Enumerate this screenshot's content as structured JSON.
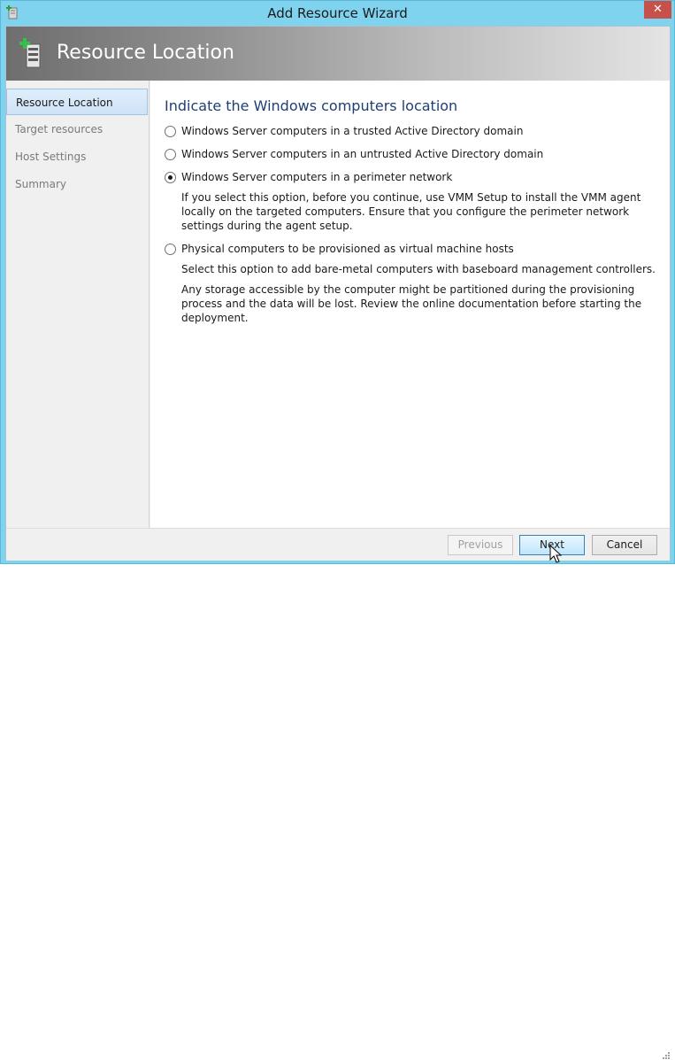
{
  "window": {
    "title": "Add Resource Wizard",
    "close_glyph": "✕"
  },
  "banner": {
    "title": "Resource Location",
    "icon": "server-add-icon"
  },
  "nav": {
    "items": [
      {
        "label": "Resource Location",
        "active": true
      },
      {
        "label": "Target resources",
        "active": false
      },
      {
        "label": "Host Settings",
        "active": false
      },
      {
        "label": "Summary",
        "active": false
      }
    ]
  },
  "content": {
    "heading": "Indicate the Windows computers location",
    "options": [
      {
        "label": "Windows Server computers in a trusted Active Directory domain",
        "checked": false
      },
      {
        "label": "Windows Server computers in an untrusted Active Directory domain",
        "checked": false
      },
      {
        "label": "Windows Server computers in a perimeter network",
        "checked": true,
        "description": "If you select this option, before you continue, use VMM Setup to install the VMM agent locally on the targeted computers. Ensure that you configure the perimeter network settings during the agent setup."
      },
      {
        "label": "Physical computers to be provisioned as virtual machine hosts",
        "checked": false,
        "description": "Select this option to add bare-metal computers with baseboard management controllers.",
        "description2": "Any storage accessible by the computer might be partitioned during the provisioning process and the data will be lost. Review the online documentation before starting the deployment."
      }
    ]
  },
  "footer": {
    "previous_label": "Previous",
    "next_label": "Next",
    "cancel_label": "Cancel"
  },
  "colors": {
    "titlebar": "#7fd3ef",
    "close": "#c7504a",
    "heading": "#1e3f73",
    "nav_active": "#cfe3f7"
  }
}
